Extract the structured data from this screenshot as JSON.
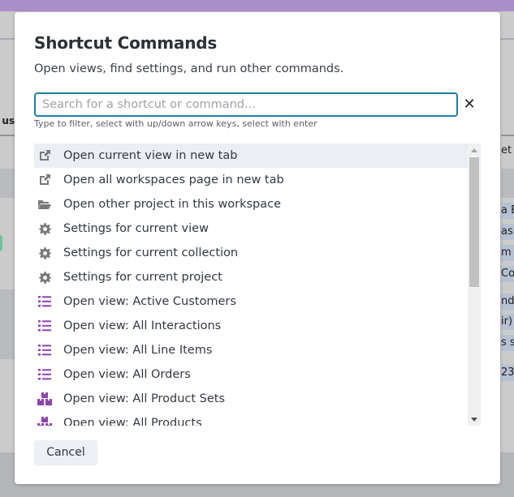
{
  "background": {
    "left_header_fragment": "us",
    "right_fragments": [
      "et",
      "a E",
      "as",
      "m",
      "Co",
      "nd",
      "ir)",
      "s s",
      "23"
    ]
  },
  "modal": {
    "title": "Shortcut Commands",
    "subtitle": "Open views, find settings, and run other commands.",
    "search": {
      "value": "",
      "placeholder": "Search for a shortcut or command..."
    },
    "clear_icon": "close-icon",
    "hint": "Type to filter, select with up/down arrow keys, select with enter",
    "colors": {
      "accent": "#1f7f9e",
      "view_icon": "#8e44ad",
      "settings_icon": "#777777",
      "active_row": "#ebeff3"
    },
    "items": [
      {
        "icon": "external-link-icon",
        "label": "Open current view in new tab",
        "active": true
      },
      {
        "icon": "external-link-icon",
        "label": "Open all workspaces page in new tab"
      },
      {
        "icon": "folder-open-icon",
        "label": "Open other project in this workspace"
      },
      {
        "icon": "gear-icon",
        "label": "Settings for current view"
      },
      {
        "icon": "gear-icon",
        "label": "Settings for current collection"
      },
      {
        "icon": "gear-icon",
        "label": "Settings for current project"
      },
      {
        "icon": "list-icon",
        "label": "Open view: Active Customers"
      },
      {
        "icon": "list-icon",
        "label": "Open view: All Interactions"
      },
      {
        "icon": "list-icon",
        "label": "Open view: All Line Items"
      },
      {
        "icon": "list-icon",
        "label": "Open view: All Orders"
      },
      {
        "icon": "boxes-icon",
        "label": "Open view: All Product Sets"
      },
      {
        "icon": "boxes-icon",
        "label": "Open view: All Products"
      }
    ],
    "cancel_label": "Cancel"
  }
}
